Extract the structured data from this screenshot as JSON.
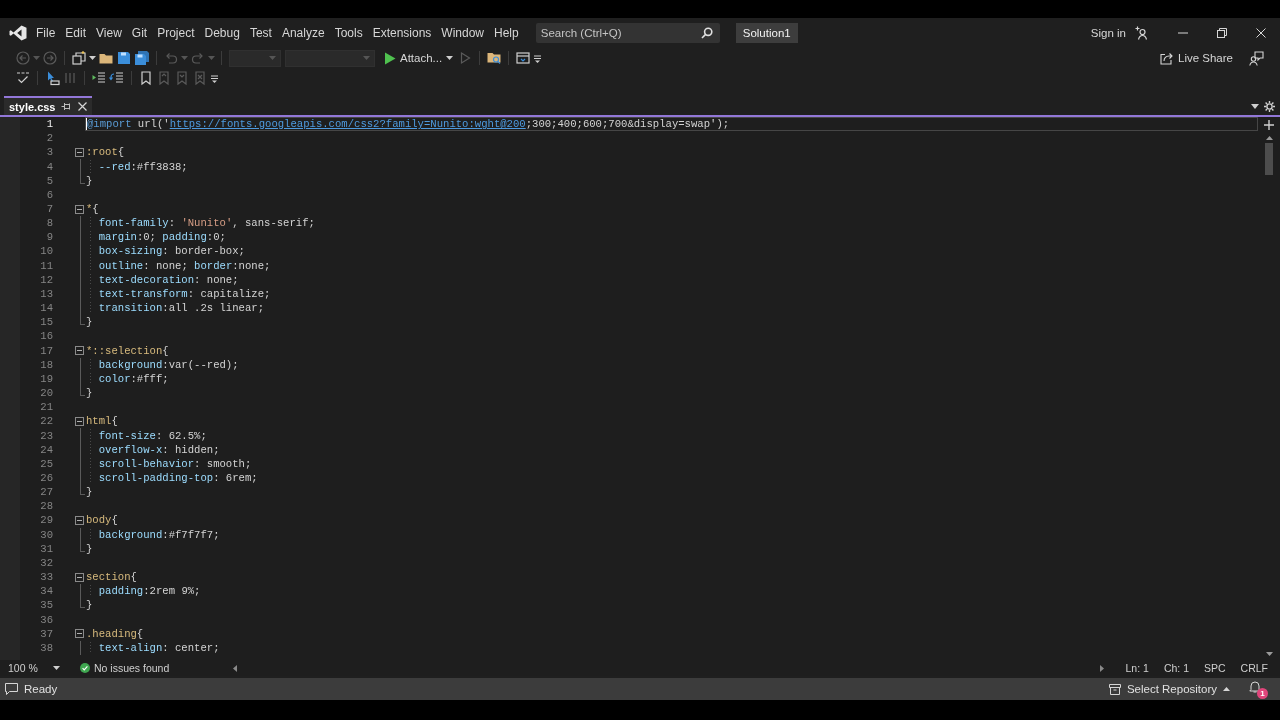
{
  "title_bar": {
    "menu": [
      "File",
      "Edit",
      "View",
      "Git",
      "Project",
      "Debug",
      "Test",
      "Analyze",
      "Tools",
      "Extensions",
      "Window",
      "Help"
    ],
    "search": {
      "placeholder": "Search (Ctrl+Q)"
    },
    "solution": "Solution1",
    "sign_in": "Sign in"
  },
  "toolbar": {
    "row_1": [
      {
        "kind": "icon",
        "disabled": true,
        "dropdown": true
      },
      {
        "kind": "icon",
        "disabled": true,
        "dropdown": false
      },
      {
        "kind": "separator"
      },
      {
        "kind": "icon",
        "disabled": false,
        "dropdown": true
      },
      {
        "kind": "icon",
        "disabled": false,
        "dropdown": false
      },
      {
        "kind": "icon",
        "disabled": false,
        "dropdown": false
      },
      {
        "kind": "icon",
        "disabled": false,
        "dropdown": false
      },
      {
        "kind": "separator"
      },
      {
        "kind": "icon",
        "disabled": true,
        "dropdown": true
      },
      {
        "kind": "icon",
        "disabled": true,
        "dropdown": true
      },
      {
        "kind": "separator"
      },
      {
        "kind": "combo",
        "disabled": true
      },
      {
        "kind": "combo",
        "disabled": true
      },
      {
        "kind": "run",
        "label": "Attach...",
        "disabled": false,
        "dropdown": true
      },
      {
        "kind": "icon",
        "disabled": true,
        "dropdown": false
      },
      {
        "kind": "separator"
      },
      {
        "kind": "icon",
        "disabled": false,
        "dropdown": false
      },
      {
        "kind": "separator"
      },
      {
        "kind": "icon",
        "disabled": false,
        "dropdown": false
      },
      {
        "kind": "overflow"
      }
    ],
    "row_2": [
      {
        "kind": "icon",
        "disabled": false
      },
      {
        "kind": "separator"
      },
      {
        "kind": "icon",
        "disabled": false
      },
      {
        "kind": "icon",
        "disabled": true
      },
      {
        "kind": "separator"
      },
      {
        "kind": "icon",
        "disabled": false
      },
      {
        "kind": "icon",
        "disabled": false
      },
      {
        "kind": "separator"
      },
      {
        "kind": "icon",
        "disabled": false
      },
      {
        "kind": "icon",
        "disabled": true
      },
      {
        "kind": "icon",
        "disabled": true
      },
      {
        "kind": "icon",
        "disabled": true
      },
      {
        "kind": "overflow"
      }
    ],
    "live_share": "Live Share"
  },
  "tabs": [
    {
      "label": "style.css",
      "selected": true
    }
  ],
  "editor": {
    "lines": [
      {
        "number": "1",
        "kind": "statement",
        "current": true,
        "tokens": [
          {
            "kind": "at_rule",
            "text": "@import"
          },
          {
            "kind": "text",
            "text": " url('"
          },
          {
            "kind": "url",
            "text": "https://fonts.googleapis.com/css2?family=Nunito:wght@200"
          },
          {
            "kind": "text",
            "text": ";300;400;600;700&display=swap');"
          }
        ]
      },
      {
        "number": "2",
        "kind": "blank",
        "current": false
      },
      {
        "number": "3",
        "kind": "rule_start",
        "current": false,
        "tokens": [
          {
            "kind": "selector",
            "text": ":root"
          },
          {
            "kind": "text",
            "text": "{"
          }
        ]
      },
      {
        "number": "4",
        "kind": "declaration",
        "current": false,
        "tokens": [
          {
            "kind": "property",
            "text": "--red"
          },
          {
            "kind": "text",
            "text": ":#ff3838;"
          }
        ]
      },
      {
        "number": "5",
        "kind": "rule_end",
        "current": false,
        "tokens": [
          {
            "kind": "text",
            "text": "}"
          }
        ]
      },
      {
        "number": "6",
        "kind": "blank",
        "current": false
      },
      {
        "number": "7",
        "kind": "rule_start",
        "current": false,
        "tokens": [
          {
            "kind": "selector",
            "text": "*"
          },
          {
            "kind": "text",
            "text": "{"
          }
        ]
      },
      {
        "number": "8",
        "kind": "declaration",
        "current": false,
        "tokens": [
          {
            "kind": "property",
            "text": "font-family"
          },
          {
            "kind": "text",
            "text": ": "
          },
          {
            "kind": "string",
            "text": "'Nunito'"
          },
          {
            "kind": "text",
            "text": ", sans-serif;"
          }
        ]
      },
      {
        "number": "9",
        "kind": "declaration",
        "current": false,
        "tokens": [
          {
            "kind": "property",
            "text": "margin"
          },
          {
            "kind": "text",
            "text": ":0; "
          },
          {
            "kind": "property",
            "text": "padding"
          },
          {
            "kind": "text",
            "text": ":0;"
          }
        ]
      },
      {
        "number": "10",
        "kind": "declaration",
        "current": false,
        "tokens": [
          {
            "kind": "property",
            "text": "box-sizing"
          },
          {
            "kind": "text",
            "text": ": border-box;"
          }
        ]
      },
      {
        "number": "11",
        "kind": "declaration",
        "current": false,
        "tokens": [
          {
            "kind": "property",
            "text": "outline"
          },
          {
            "kind": "text",
            "text": ": none; "
          },
          {
            "kind": "property",
            "text": "border"
          },
          {
            "kind": "text",
            "text": ":none;"
          }
        ]
      },
      {
        "number": "12",
        "kind": "declaration",
        "current": false,
        "tokens": [
          {
            "kind": "property",
            "text": "text-decoration"
          },
          {
            "kind": "text",
            "text": ": none;"
          }
        ]
      },
      {
        "number": "13",
        "kind": "declaration",
        "current": false,
        "tokens": [
          {
            "kind": "property",
            "text": "text-transform"
          },
          {
            "kind": "text",
            "text": ": capitalize;"
          }
        ]
      },
      {
        "number": "14",
        "kind": "declaration",
        "current": false,
        "tokens": [
          {
            "kind": "property",
            "text": "transition"
          },
          {
            "kind": "text",
            "text": ":all .2s linear;"
          }
        ]
      },
      {
        "number": "15",
        "kind": "rule_end",
        "current": false,
        "tokens": [
          {
            "kind": "text",
            "text": "}"
          }
        ]
      },
      {
        "number": "16",
        "kind": "blank",
        "current": false
      },
      {
        "number": "17",
        "kind": "rule_start",
        "current": false,
        "tokens": [
          {
            "kind": "selector",
            "text": "*::selection"
          },
          {
            "kind": "text",
            "text": "{"
          }
        ]
      },
      {
        "number": "18",
        "kind": "declaration",
        "current": false,
        "tokens": [
          {
            "kind": "property",
            "text": "background"
          },
          {
            "kind": "text",
            "text": ":var(--red);"
          }
        ]
      },
      {
        "number": "19",
        "kind": "declaration",
        "current": false,
        "tokens": [
          {
            "kind": "property",
            "text": "color"
          },
          {
            "kind": "text",
            "text": ":#fff;"
          }
        ]
      },
      {
        "number": "20",
        "kind": "rule_end",
        "current": false,
        "tokens": [
          {
            "kind": "text",
            "text": "}"
          }
        ]
      },
      {
        "number": "21",
        "kind": "blank",
        "current": false
      },
      {
        "number": "22",
        "kind": "rule_start",
        "current": false,
        "tokens": [
          {
            "kind": "selector",
            "text": "html"
          },
          {
            "kind": "text",
            "text": "{"
          }
        ]
      },
      {
        "number": "23",
        "kind": "declaration",
        "current": false,
        "tokens": [
          {
            "kind": "property",
            "text": "font-size"
          },
          {
            "kind": "text",
            "text": ": 62.5%;"
          }
        ]
      },
      {
        "number": "24",
        "kind": "declaration",
        "current": false,
        "tokens": [
          {
            "kind": "property",
            "text": "overflow-x"
          },
          {
            "kind": "text",
            "text": ": hidden;"
          }
        ]
      },
      {
        "number": "25",
        "kind": "declaration",
        "current": false,
        "tokens": [
          {
            "kind": "property",
            "text": "scroll-behavior"
          },
          {
            "kind": "text",
            "text": ": smooth;"
          }
        ]
      },
      {
        "number": "26",
        "kind": "declaration",
        "current": false,
        "tokens": [
          {
            "kind": "property",
            "text": "scroll-padding-top"
          },
          {
            "kind": "text",
            "text": ": 6rem;"
          }
        ]
      },
      {
        "number": "27",
        "kind": "rule_end",
        "current": false,
        "tokens": [
          {
            "kind": "text",
            "text": "}"
          }
        ]
      },
      {
        "number": "28",
        "kind": "blank",
        "current": false
      },
      {
        "number": "29",
        "kind": "rule_start",
        "current": false,
        "tokens": [
          {
            "kind": "selector",
            "text": "body"
          },
          {
            "kind": "text",
            "text": "{"
          }
        ]
      },
      {
        "number": "30",
        "kind": "declaration",
        "current": false,
        "tokens": [
          {
            "kind": "property",
            "text": "background"
          },
          {
            "kind": "text",
            "text": ":#f7f7f7;"
          }
        ]
      },
      {
        "number": "31",
        "kind": "rule_end",
        "current": false,
        "tokens": [
          {
            "kind": "text",
            "text": "}"
          }
        ]
      },
      {
        "number": "32",
        "kind": "blank",
        "current": false
      },
      {
        "number": "33",
        "kind": "rule_start",
        "current": false,
        "tokens": [
          {
            "kind": "selector",
            "text": "section"
          },
          {
            "kind": "text",
            "text": "{"
          }
        ]
      },
      {
        "number": "34",
        "kind": "declaration",
        "current": false,
        "tokens": [
          {
            "kind": "property",
            "text": "padding"
          },
          {
            "kind": "text",
            "text": ":2rem 9%;"
          }
        ]
      },
      {
        "number": "35",
        "kind": "rule_end",
        "current": false,
        "tokens": [
          {
            "kind": "text",
            "text": "}"
          }
        ]
      },
      {
        "number": "36",
        "kind": "blank",
        "current": false
      },
      {
        "number": "37",
        "kind": "rule_start",
        "current": false,
        "tokens": [
          {
            "kind": "selector",
            "text": ".heading"
          },
          {
            "kind": "text",
            "text": "{"
          }
        ]
      },
      {
        "number": "38",
        "kind": "declaration",
        "current": false,
        "tokens": [
          {
            "kind": "property",
            "text": "text-align"
          },
          {
            "kind": "text",
            "text": ": center;"
          }
        ]
      }
    ]
  },
  "editor_status": {
    "zoom": "100 %",
    "issues": "No issues found",
    "line": "Ln: 1",
    "column": "Ch: 1",
    "whitespace": "SPC",
    "line_ending": "CRLF"
  },
  "status_bar": {
    "text": "Ready",
    "repository": "Select Repository",
    "notification_count": "1"
  }
}
